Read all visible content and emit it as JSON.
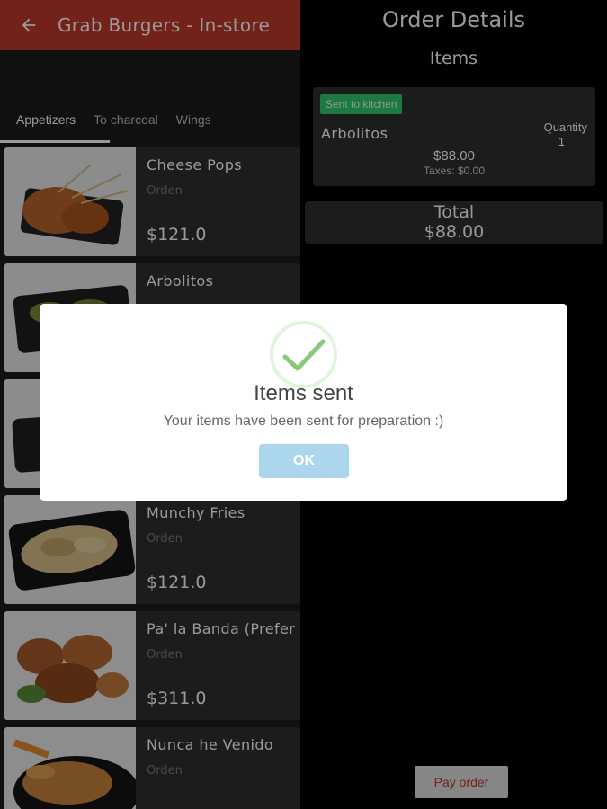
{
  "header": {
    "title": "Grab Burgers - In-store"
  },
  "tabs": [
    {
      "label": "Appetizers",
      "active": true
    },
    {
      "label": "To charcoal",
      "active": false
    },
    {
      "label": "Wings",
      "active": false
    }
  ],
  "menu_items": [
    {
      "name": "Cheese Pops",
      "sub": "Orden",
      "price": "$121.0"
    },
    {
      "name": "Arbolitos",
      "sub": "",
      "price": ""
    },
    {
      "name": "",
      "sub": "",
      "price": ""
    },
    {
      "name": "Munchy Fries",
      "sub": "Orden",
      "price": "$121.0"
    },
    {
      "name": "Pa' la Banda (Prefer",
      "sub": "Orden",
      "price": "$311.0"
    },
    {
      "name": "Nunca he Venido",
      "sub": "Orden",
      "price": ""
    }
  ],
  "order": {
    "title": "Order Details",
    "subtitle": "Items",
    "item": {
      "status": "Sent to kitchen",
      "name": "Arbolitos",
      "quantity_label": "Quantity",
      "quantity": "1",
      "price": "$88.00",
      "taxes": "Taxes: $0.00"
    },
    "total_label": "Total",
    "total_value": "$88.00",
    "pay_label": "Pay order"
  },
  "modal": {
    "title": "Items sent",
    "message": "Your items have been sent for preparation :)",
    "ok_label": "OK"
  },
  "colors": {
    "brand_red": "#c0392b",
    "success_green": "#2ecc71",
    "ok_button": "#acd6ee"
  }
}
